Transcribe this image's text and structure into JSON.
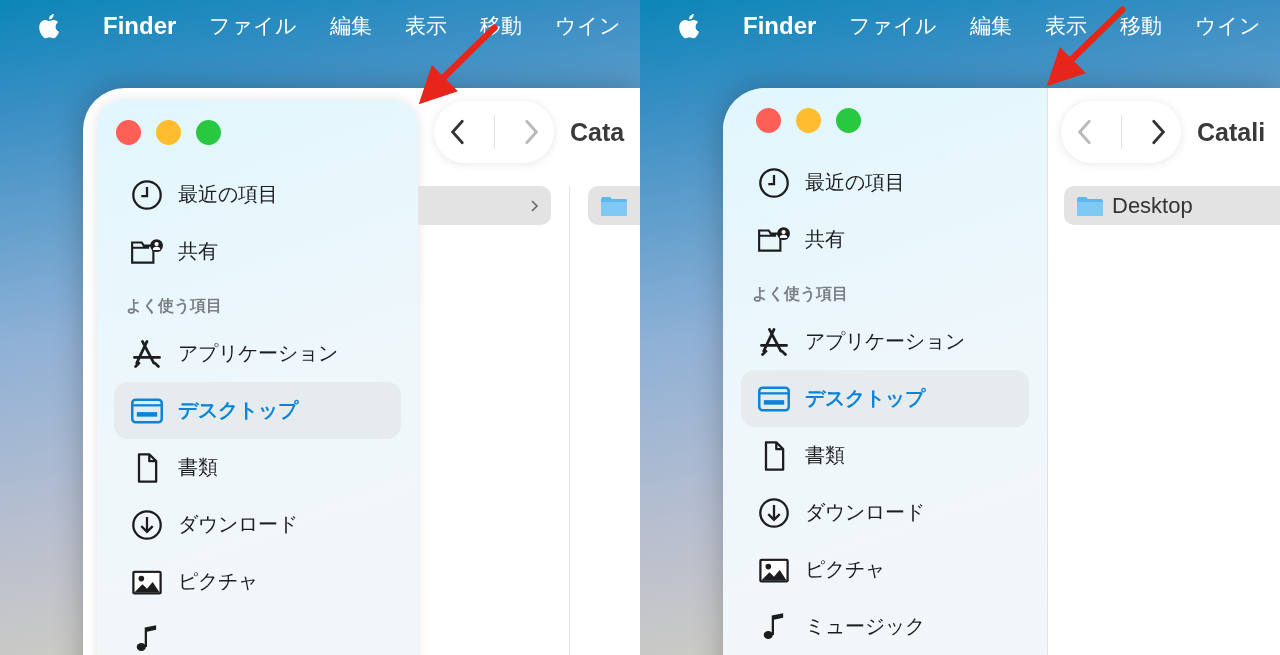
{
  "panels": [
    {
      "sidebar_floating": true,
      "menu_bar": {
        "app": "Finder",
        "items": [
          "ファイル",
          "編集",
          "表示",
          "移動",
          "ウイン"
        ]
      },
      "window": {
        "back_disabled": false,
        "forward_disabled": true,
        "title": "Cata",
        "sidebar": {
          "top_items": [
            {
              "kind": "recents",
              "label": "最近の項目",
              "selected": false
            },
            {
              "kind": "shared",
              "label": "共有",
              "selected": false
            }
          ],
          "section_header": "よく使う項目",
          "items": [
            {
              "kind": "applications",
              "label": "アプリケーション",
              "selected": false
            },
            {
              "kind": "desktop",
              "label": "デスクトップ",
              "selected": true
            },
            {
              "kind": "documents",
              "label": "書類",
              "selected": false
            },
            {
              "kind": "downloads",
              "label": "ダウンロード",
              "selected": false
            },
            {
              "kind": "pictures",
              "label": "ピクチャ",
              "selected": false
            },
            {
              "kind": "music",
              "selected": false
            }
          ]
        },
        "columns": [
          {
            "rows": [
              {
                "folder": false,
                "chevron": true,
                "selected": true
              }
            ]
          },
          {
            "rows": [
              {
                "folder": true,
                "chevron": false,
                "selected": true
              }
            ]
          }
        ]
      }
    },
    {
      "sidebar_floating": false,
      "menu_bar": {
        "app": "Finder",
        "items": [
          "ファイル",
          "編集",
          "表示",
          "移動",
          "ウイン"
        ]
      },
      "window": {
        "back_disabled": true,
        "forward_disabled": false,
        "title": "Catali",
        "sidebar": {
          "top_items": [
            {
              "kind": "recents",
              "label": "最近の項目",
              "selected": false
            },
            {
              "kind": "shared",
              "label": "共有",
              "selected": false
            }
          ],
          "section_header": "よく使う項目",
          "items": [
            {
              "kind": "applications",
              "label": "アプリケーション",
              "selected": false
            },
            {
              "kind": "desktop",
              "label": "デスクトップ",
              "selected": true
            },
            {
              "kind": "documents",
              "label": "書類",
              "selected": false
            },
            {
              "kind": "downloads",
              "label": "ダウンロード",
              "selected": false
            },
            {
              "kind": "pictures",
              "label": "ピクチャ",
              "selected": false
            },
            {
              "kind": "music",
              "label": "ミュージック",
              "selected": false
            }
          ]
        },
        "columns": [
          {
            "rows": [
              {
                "folder": true,
                "chevron": false,
                "selected": true,
                "label": "Desktop"
              }
            ]
          }
        ]
      }
    }
  ]
}
